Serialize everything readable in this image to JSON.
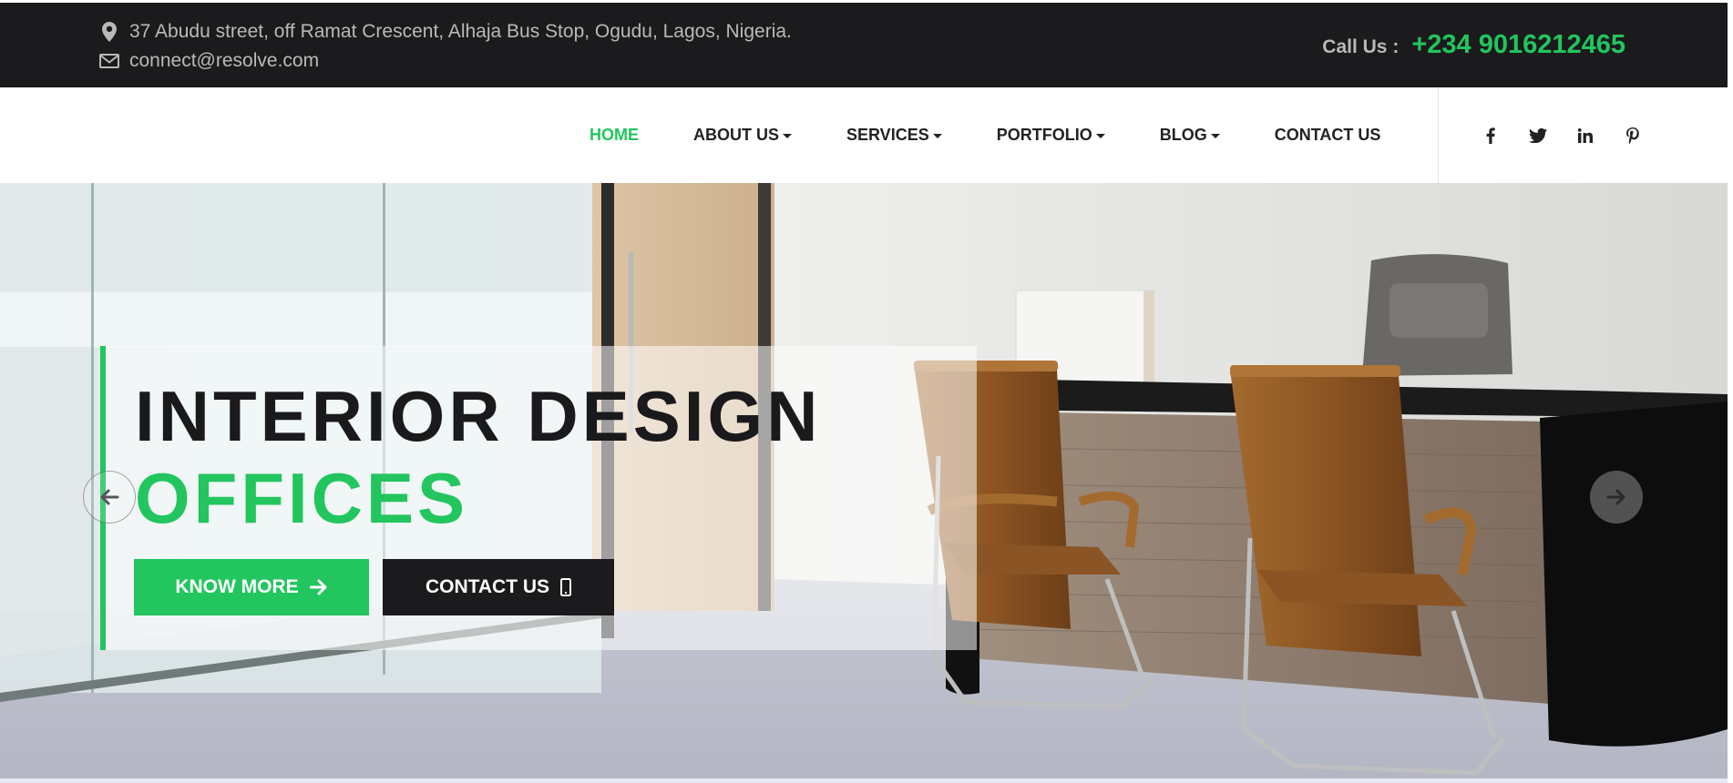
{
  "topbar": {
    "address": "37 Abudu street, off Ramat Crescent, Alhaja Bus Stop, Ogudu, Lagos, Nigeria.",
    "email": "connect@resolve.com",
    "call_label": "Call Us :",
    "call_number": "+234 9016212465",
    "address_icon": "map-marker-icon",
    "email_icon": "envelope-icon"
  },
  "nav": {
    "items": [
      {
        "label": "HOME",
        "active": true,
        "dropdown": false
      },
      {
        "label": "ABOUT US",
        "active": false,
        "dropdown": true
      },
      {
        "label": "SERVICES",
        "active": false,
        "dropdown": true
      },
      {
        "label": "PORTFOLIO",
        "active": false,
        "dropdown": true
      },
      {
        "label": "BLOG",
        "active": false,
        "dropdown": true
      },
      {
        "label": "CONTACT US",
        "active": false,
        "dropdown": false
      }
    ],
    "social": [
      "facebook-icon",
      "twitter-icon",
      "linkedin-icon",
      "pinterest-icon"
    ]
  },
  "hero": {
    "title_line1": "INTERIOR DESIGN",
    "title_line2": "OFFICES",
    "primary_button": "KNOW MORE",
    "secondary_button": "CONTACT US",
    "primary_button_icon": "arrow-right-icon",
    "secondary_button_icon": "mobile-phone-icon",
    "prev_icon": "arrow-left-icon",
    "next_icon": "arrow-right-icon"
  },
  "colors": {
    "accent": "#22c55e",
    "dark": "#1b1b1d",
    "topbar_text": "#b9b9b9"
  }
}
